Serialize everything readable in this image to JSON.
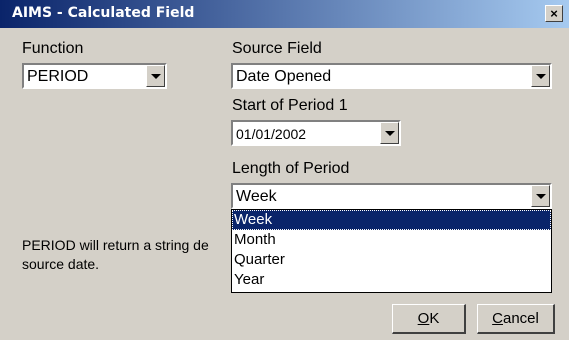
{
  "window": {
    "title": "AIMS - Calculated Field",
    "close_glyph": "×"
  },
  "function": {
    "label": "Function",
    "value": "PERIOD"
  },
  "source_field": {
    "label": "Source Field",
    "value": "Date Opened"
  },
  "start_period": {
    "label": "Start of Period 1",
    "value": "01/01/2002"
  },
  "length_period": {
    "label": "Length of Period",
    "value": "Week",
    "options": [
      "Week",
      "Month",
      "Quarter",
      "Year"
    ],
    "selected_index": 0
  },
  "description": "PERIOD will return a string de source date.",
  "buttons": {
    "ok_first": "O",
    "ok_rest": "K",
    "cancel_first": "C",
    "cancel_rest": "ancel"
  },
  "colors": {
    "titlebar_start": "#0a246a",
    "titlebar_end": "#a6caf0",
    "face": "#d4d0c8",
    "selection": "#0a246a"
  }
}
